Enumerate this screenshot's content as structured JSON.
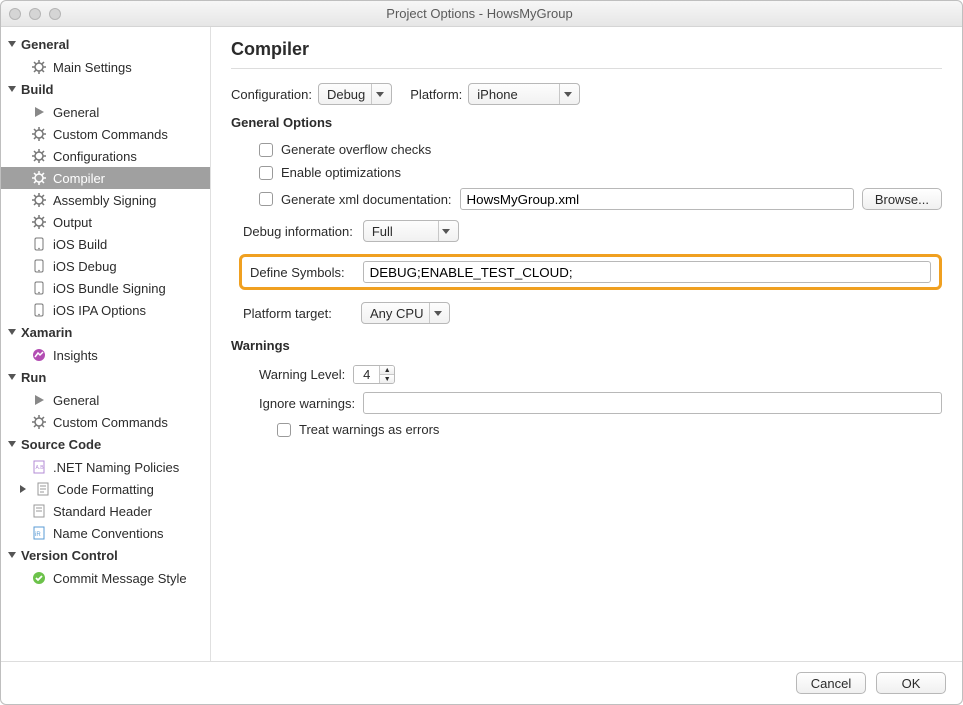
{
  "window_title": "Project Options - HowsMyGroup",
  "sidebar": {
    "general": {
      "label": "General",
      "items": [
        {
          "label": "Main Settings"
        }
      ]
    },
    "build": {
      "label": "Build",
      "items": [
        {
          "label": "General"
        },
        {
          "label": "Custom Commands"
        },
        {
          "label": "Configurations"
        },
        {
          "label": "Compiler"
        },
        {
          "label": "Assembly Signing"
        },
        {
          "label": "Output"
        },
        {
          "label": "iOS Build"
        },
        {
          "label": "iOS Debug"
        },
        {
          "label": "iOS Bundle Signing"
        },
        {
          "label": "iOS IPA Options"
        }
      ]
    },
    "xamarin": {
      "label": "Xamarin",
      "items": [
        {
          "label": "Insights"
        }
      ]
    },
    "run": {
      "label": "Run",
      "items": [
        {
          "label": "General"
        },
        {
          "label": "Custom Commands"
        }
      ]
    },
    "source": {
      "label": "Source Code",
      "items": [
        {
          "label": ".NET Naming Policies"
        },
        {
          "label": "Code Formatting"
        },
        {
          "label": "Standard Header"
        },
        {
          "label": "Name Conventions"
        }
      ]
    },
    "vc": {
      "label": "Version Control",
      "items": [
        {
          "label": "Commit Message Style"
        }
      ]
    }
  },
  "main": {
    "title": "Compiler",
    "config_label": "Configuration:",
    "config_value": "Debug",
    "platform_label": "Platform:",
    "platform_value": "iPhone",
    "section_general": "General Options",
    "gen_overflow": "Generate overflow checks",
    "enable_opt": "Enable optimizations",
    "gen_xml": "Generate xml documentation:",
    "gen_xml_value": "HowsMyGroup.xml",
    "browse": "Browse...",
    "debug_info_label": "Debug information:",
    "debug_info_value": "Full",
    "define_symbols_label": "Define Symbols:",
    "define_symbols_value": "DEBUG;ENABLE_TEST_CLOUD;",
    "platform_target_label": "Platform target:",
    "platform_target_value": "Any CPU",
    "section_warnings": "Warnings",
    "warning_level_label": "Warning Level:",
    "warning_level_value": "4",
    "ignore_warnings_label": "Ignore warnings:",
    "ignore_warnings_value": "",
    "treat_as_errors": "Treat warnings as errors"
  },
  "footer": {
    "cancel": "Cancel",
    "ok": "OK"
  }
}
